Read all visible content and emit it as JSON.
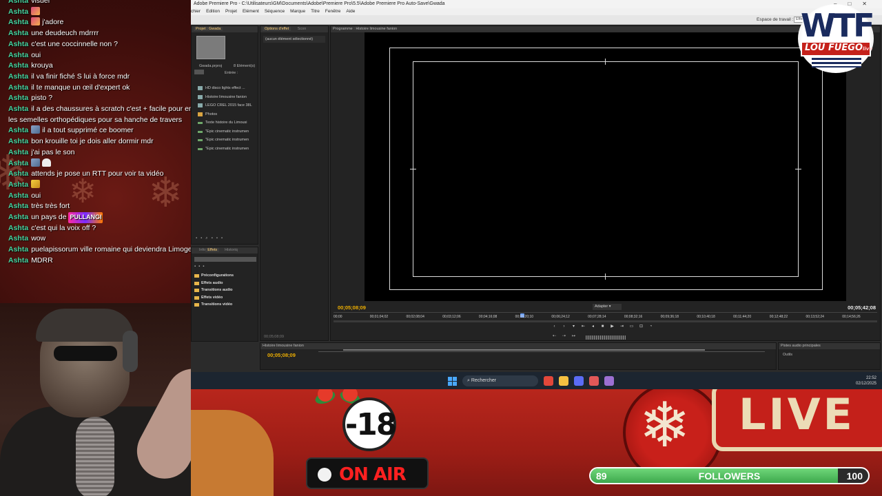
{
  "chat": {
    "messages": [
      {
        "user": "Ashta",
        "text": "visuel",
        "emote": ""
      },
      {
        "user": "Ashta",
        "text": "",
        "emote": "pink"
      },
      {
        "user": "Ashta",
        "text": "j'adore",
        "emote": "pink"
      },
      {
        "user": "Ashta",
        "text": "une deudeuch mdrrrr",
        "emote": ""
      },
      {
        "user": "Ashta",
        "text": "c'est une coccinnelle non ?",
        "emote": ""
      },
      {
        "user": "Ashta",
        "text": "oui",
        "emote": ""
      },
      {
        "user": "Ashta",
        "text": "krouya",
        "emote": ""
      },
      {
        "user": "Ashta",
        "text": "il va finir fiché S lui à force mdr",
        "emote": ""
      },
      {
        "user": "Ashta",
        "text": "il te manque un œil d'expert ok",
        "emote": ""
      },
      {
        "user": "Ashta",
        "text": "pisto ?",
        "emote": ""
      },
      {
        "user": "Ashta",
        "text": "il a des chaussures à scratch c'est + facile pour enfiler les semelles orthopédiques pour sa hanche de travers",
        "emote": "",
        "wrap": true
      },
      {
        "user": "Ashta",
        "text": "il a tout supprimé ce boomer",
        "emote": "gray"
      },
      {
        "user": "Ashta",
        "text": "bon krouille toi je dois aller dormir mdr",
        "emote": ""
      },
      {
        "user": "Ashta",
        "text": "j'ai pas le son",
        "emote": ""
      },
      {
        "user": "Ashta",
        "text": "",
        "emote": "gray-ghost"
      },
      {
        "user": "Ashta",
        "text": "attends je pose un RTT pour voir ta vidéo",
        "emote": ""
      },
      {
        "user": "Ashta",
        "text": "",
        "emote": "yellow"
      },
      {
        "user": "Ashta",
        "text": "oui",
        "emote": ""
      },
      {
        "user": "Ashta",
        "text": "très très fort",
        "emote": ""
      },
      {
        "user": "Ashta",
        "text": "un pays de ",
        "emote": "",
        "badge": "PULLANGI"
      },
      {
        "user": "Ashta",
        "text": "c'est qui la voix off ?",
        "emote": ""
      },
      {
        "user": "Ashta",
        "text": "wow",
        "emote": ""
      },
      {
        "user": "Ashta",
        "text": "puelapissorum ville romaine qui deviendra Limoges",
        "emote": ""
      },
      {
        "user": "Ashta",
        "text": "MDRR",
        "emote": ""
      }
    ]
  },
  "premiere": {
    "window_title": "Adobe Premiere Pro - C:\\Utilisateurs\\GM\\Documents\\Adobe\\Premiere Pro\\5.5\\Adobe Premiere Pro Auto-Save\\Gwada",
    "menu": [
      "chier",
      "Edition",
      "Projet",
      "Elément",
      "Séquence",
      "Marque",
      "Titre",
      "Fenêtre",
      "Aide"
    ],
    "workspace_label": "Espace de travail :",
    "workspace_value": "Effe",
    "project_panel": {
      "tab": "Projet : Gwada",
      "file": "Gwada.prproj",
      "count": "8 Elément(s)",
      "entry_label": "Entrée :",
      "items": [
        {
          "label": "HD disco lights effect ...",
          "kind": "clip"
        },
        {
          "label": "Histoire limousine fanion",
          "kind": "seq"
        },
        {
          "label": "LEGO CREL 2015 face 38L",
          "kind": "clip"
        },
        {
          "label": "Photos",
          "kind": "folder"
        },
        {
          "label": "Texte histoire du Limousi",
          "kind": "audio"
        },
        {
          "label": "\"Epic cinematic instrumen",
          "kind": "audio"
        },
        {
          "label": "\"Epic cinematic instrumen",
          "kind": "audio"
        },
        {
          "label": "\"Epic cinematic instrumen",
          "kind": "audio"
        }
      ]
    },
    "effect_controls": {
      "tab": "Options d'effet",
      "tab2": "Scon",
      "empty_label": "(aucun élément sélectionné)",
      "timecode": "00;05;08;09"
    },
    "effects_panel": {
      "tabs": [
        "Info",
        "Effets",
        "Historiq"
      ],
      "items": [
        "Préconfigurations",
        "Effets audio",
        "Transitions audio",
        "Effets vidéo",
        "Transitions vidéo"
      ]
    },
    "program_monitor": {
      "tab": "Programme : Histoire limousine fanion",
      "current_tc": "00;05;08;09",
      "total_tc": "00;05;42;08",
      "fit": "Adapter",
      "ruler": [
        "00;00",
        "00;01;04;02",
        "00;02;08;04",
        "00;03;12;06",
        "00;04;16;08",
        "00;05;20;10",
        "00;06;24;12",
        "00;07;28;14",
        "00;08;32;16",
        "00;09;36;18",
        "00;10;40;18",
        "00;11;44;20",
        "00;12;48;22",
        "00;13;52;24",
        "00;14;56;26"
      ],
      "playhead_fraction": 0.343
    },
    "timeline": {
      "tab": "Histoire limousine fanion",
      "timecode": "00;05;08;09"
    },
    "audio_master": {
      "tab": "Pistes audio principales",
      "tools": "Outils"
    }
  },
  "taskbar": {
    "search": "Rechercher",
    "time": "22:52",
    "date": "02/12/2025",
    "apps": [
      "#e2473a",
      "#f5c041",
      "#5b6cf5",
      "#e25858",
      "#9c6fd2"
    ]
  },
  "overlay": {
    "age_rating": "-18",
    "on_air": "ON AIR",
    "live": "LIVE",
    "followers_current": "89",
    "followers_label": "FOLLOWERS",
    "followers_goal": "100",
    "followers_progress": 0.89,
    "logo_top": "WTF",
    "logo_band": "LOU FUEGO",
    "logo_suffix": "live"
  }
}
